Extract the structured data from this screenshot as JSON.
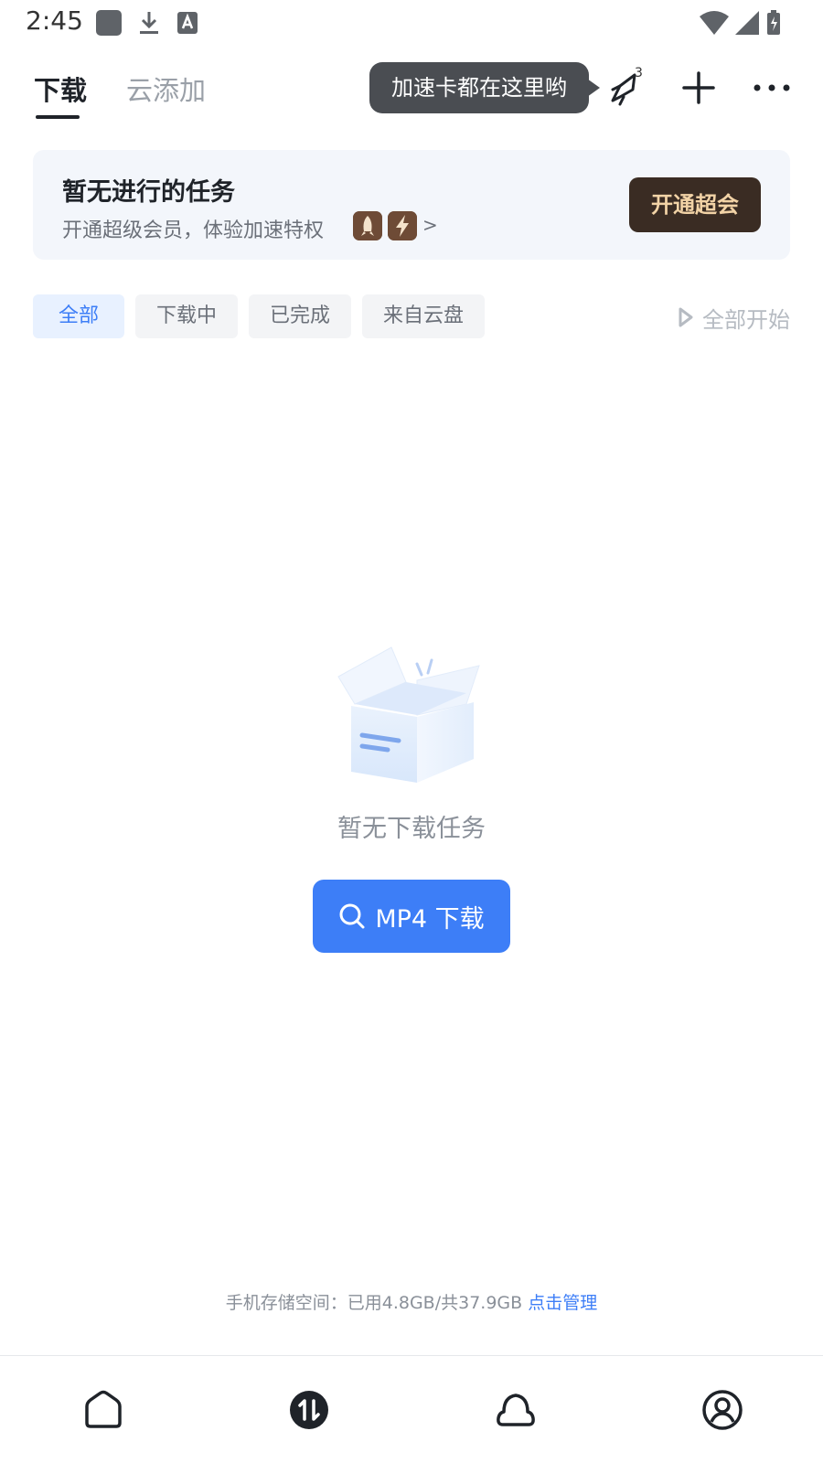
{
  "status_bar": {
    "time": "2:45"
  },
  "header": {
    "tabs": [
      {
        "label": "下载",
        "active": true
      },
      {
        "label": "云添加",
        "active": false
      }
    ],
    "tooltip": "加速卡都在这里哟",
    "notification_count": "3",
    "icons": [
      "speed-card-icon",
      "plus-icon",
      "more-icon"
    ]
  },
  "banner": {
    "title": "暂无进行的任务",
    "subtitle": "开通超级会员，体验加速特权",
    "arrow": ">",
    "button_label": "开通超会"
  },
  "filters": {
    "chips": [
      "全部",
      "下载中",
      "已完成",
      "来自云盘"
    ],
    "active_index": 0,
    "start_all": "全部开始"
  },
  "empty_state": {
    "message": "暂无下载任务",
    "button_label": "MP4 下载"
  },
  "storage": {
    "text": "手机存储空间：已用4.8GB/共37.9GB",
    "link": "点击管理"
  },
  "bottom_nav": {
    "items": [
      "home-icon",
      "transfer-icon",
      "cloud-icon",
      "profile-icon"
    ],
    "active_index": 1
  },
  "colors": {
    "accent": "#3d7ef7",
    "vip_button": "#3a2c23",
    "vip_text": "#f2d3a6",
    "tooltip_bg": "#4a4d52"
  }
}
